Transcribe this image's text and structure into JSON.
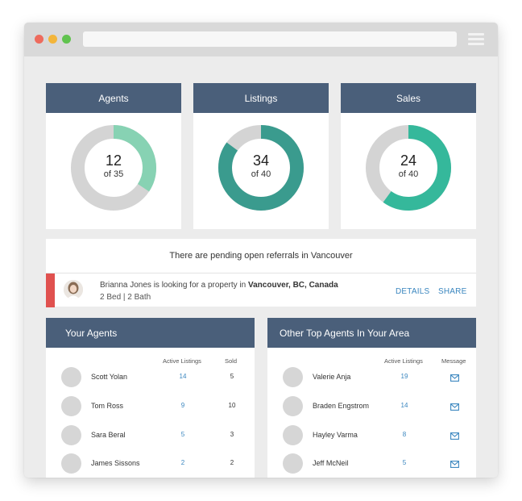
{
  "colors": {
    "header": "#4a5f7a",
    "ring_track": "#d4d4d4",
    "agents_ring": "#87d2b3",
    "listings_ring": "#3a9b8e",
    "sales_ring": "#35b89b",
    "alert_red": "#e0514f",
    "link_blue": "#3a86bf",
    "dot_red": "#ee6b5d",
    "dot_yellow": "#f3b53a",
    "dot_green": "#60c34e"
  },
  "stats": [
    {
      "title": "Agents",
      "value": "12",
      "of": "of 35",
      "fraction": 0.343
    },
    {
      "title": "Listings",
      "value": "34",
      "of": "of 40",
      "fraction": 0.85
    },
    {
      "title": "Sales",
      "value": "24",
      "of": "of 40",
      "fraction": 0.6
    }
  ],
  "referral": {
    "title": "There are pending open referrals in Vancouver",
    "text_prefix": "Brianna Jones is looking for a property in ",
    "location": "Vancouver, BC, Canada",
    "details": "2 Bed | 2 Bath",
    "details_link": "DETAILS",
    "share_link": "SHARE"
  },
  "your_agents": {
    "title": "Your Agents",
    "col_active": "Active Listings",
    "col_sold": "Sold",
    "rows": [
      {
        "name": "Scott Yolan",
        "active": "14",
        "sold": "5"
      },
      {
        "name": "Tom Ross",
        "active": "9",
        "sold": "10"
      },
      {
        "name": "Sara Beral",
        "active": "5",
        "sold": "3"
      },
      {
        "name": "James Sissons",
        "active": "2",
        "sold": "2"
      }
    ]
  },
  "other_agents": {
    "title": "Other Top Agents In Your Area",
    "col_active": "Active Listings",
    "col_message": "Message",
    "rows": [
      {
        "name": "Valerie Anja",
        "active": "19"
      },
      {
        "name": "Braden Engstrom",
        "active": "14"
      },
      {
        "name": "Hayley Varma",
        "active": "8"
      },
      {
        "name": "Jeff McNeil",
        "active": "5"
      }
    ]
  }
}
